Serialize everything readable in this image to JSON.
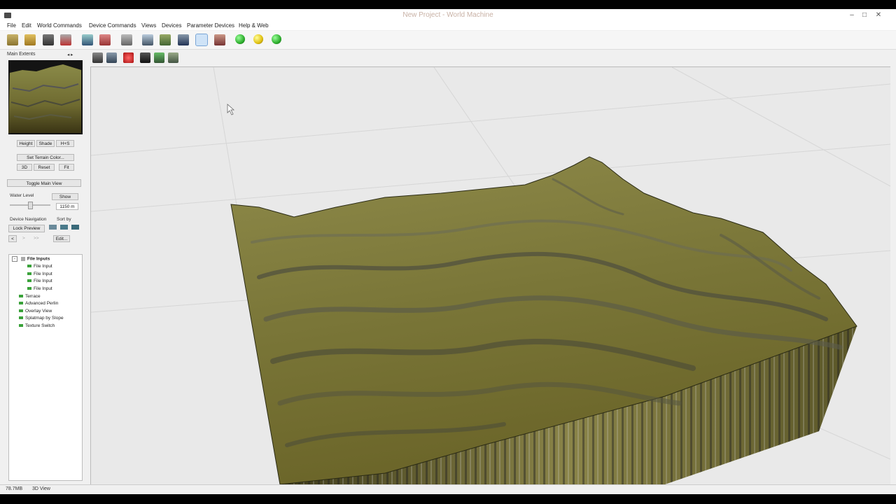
{
  "window": {
    "title": "New Project - World Machine",
    "controls": [
      "–",
      "□",
      "✕"
    ]
  },
  "menu": [
    "File",
    "Edit",
    "World Commands",
    "Device Commands",
    "Views",
    "Devices",
    "Parameter Devices",
    "Help & Web"
  ],
  "side_panel": {
    "title": "Main Extents",
    "view_buttons": [
      "Height",
      "Shade",
      "H+S"
    ],
    "set_color_label": "Set Terrain Color...",
    "mini_buttons": [
      "3D",
      "Reset",
      "Fit"
    ],
    "toggle_label": "Toggle Main View",
    "water_level_label": "Water Level",
    "show_label": "Show",
    "water_value": "1150 m",
    "device_nav_label": "Device Navigation",
    "sort_label": "Sort by",
    "lock_preview_label": "Lock Preview",
    "nav_back": "<",
    "nav_fwd": ">",
    "nav_fwd2": ">>",
    "edit_label": "Edit...",
    "tree": {
      "group": "File Inputs",
      "children": [
        "File Input",
        "File Input",
        "File Input",
        "File Input"
      ],
      "items": [
        "Terrace",
        "Advanced Perlin",
        "Overlay View",
        "Splatmap by Slope",
        "Texture Switch"
      ]
    }
  },
  "status": {
    "memory": "78.7MB",
    "view": "3D View"
  },
  "colors": {
    "accent": "#7aa6d6",
    "tree_dot": "#3aa23a",
    "orb_green": "#2eae2e",
    "orb_yellow": "#e0c010"
  }
}
